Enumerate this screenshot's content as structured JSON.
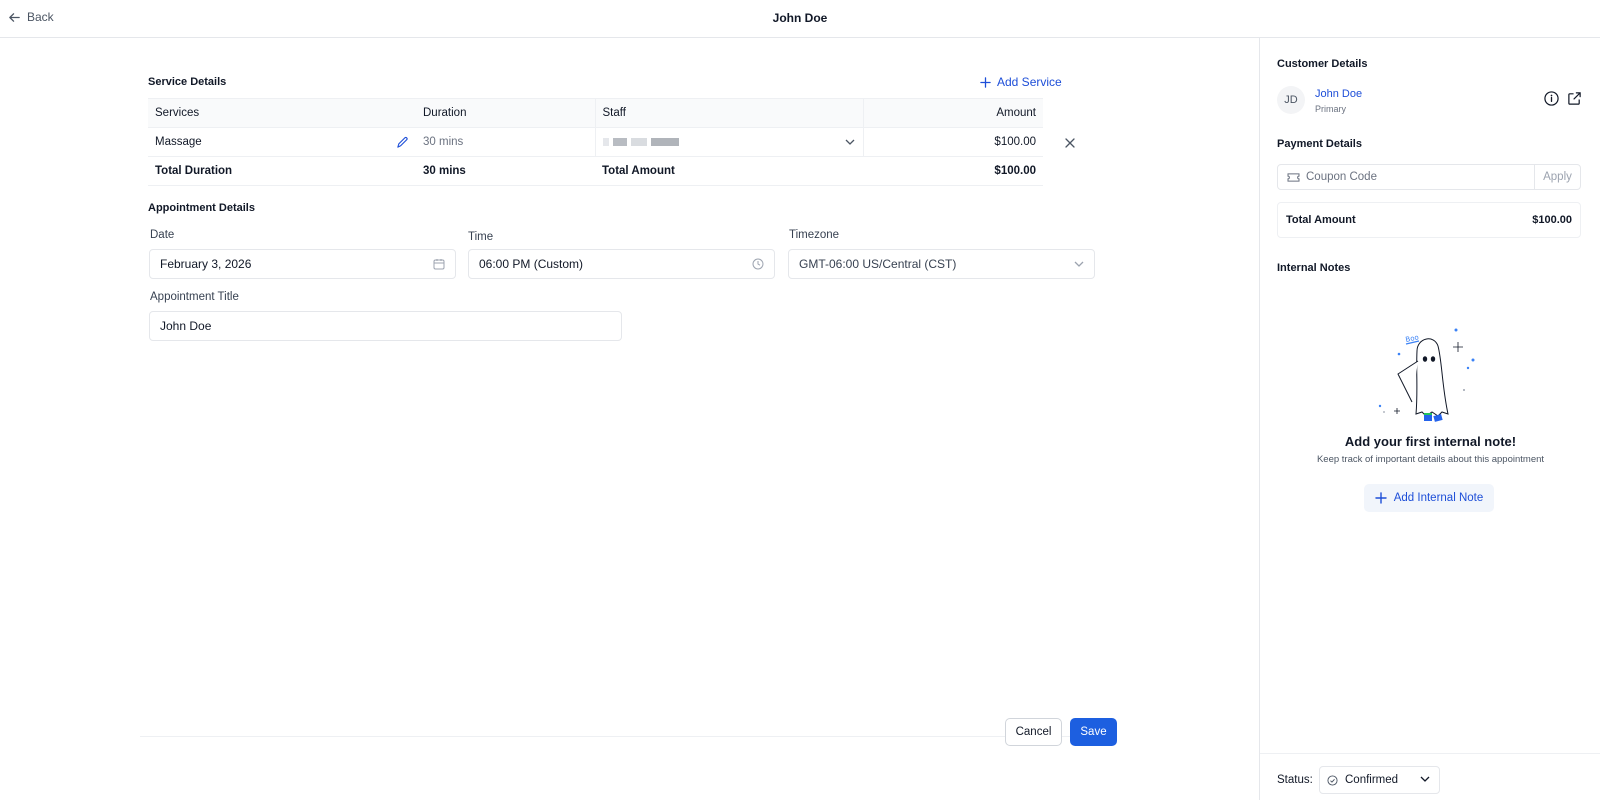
{
  "header": {
    "back_label": "Back",
    "title": "John Doe"
  },
  "service_details": {
    "title": "Service Details",
    "add_label": "Add Service",
    "columns": [
      "Services",
      "Duration",
      "Staff",
      "Amount"
    ],
    "rows": [
      {
        "service": "Massage",
        "duration": "30 mins",
        "amount": "$100.00"
      }
    ],
    "total": {
      "duration_label": "Total Duration",
      "duration": "30 mins",
      "amount_label": "Total Amount",
      "amount": "$100.00"
    }
  },
  "appointment": {
    "title": "Appointment Details",
    "date_label": "Date",
    "date_value": "February 3, 2026",
    "time_label": "Time",
    "time_value": "06:00 PM (Custom)",
    "timezone_label": "Timezone",
    "timezone_value": "GMT-06:00 US/Central (CST)",
    "title_label": "Appointment Title",
    "title_value": "John Doe"
  },
  "actions": {
    "cancel": "Cancel",
    "save": "Save"
  },
  "sidebar": {
    "customer_title": "Customer Details",
    "customer_initials": "JD",
    "customer_name": "John Doe",
    "customer_tag": "Primary",
    "payment_title": "Payment Details",
    "coupon_placeholder": "Coupon Code",
    "apply_label": "Apply",
    "total_label": "Total Amount",
    "total_value": "$100.00",
    "notes_title": "Internal Notes",
    "empty_title": "Add your first internal note!",
    "empty_sub": "Keep track of important details about this appointment",
    "add_note_label": "Add Internal Note",
    "status_label": "Status:",
    "status_value": "Confirmed"
  },
  "colors": {
    "accent": "#1d5fe0",
    "link": "#1d4ed8",
    "border": "#e5e7eb"
  }
}
